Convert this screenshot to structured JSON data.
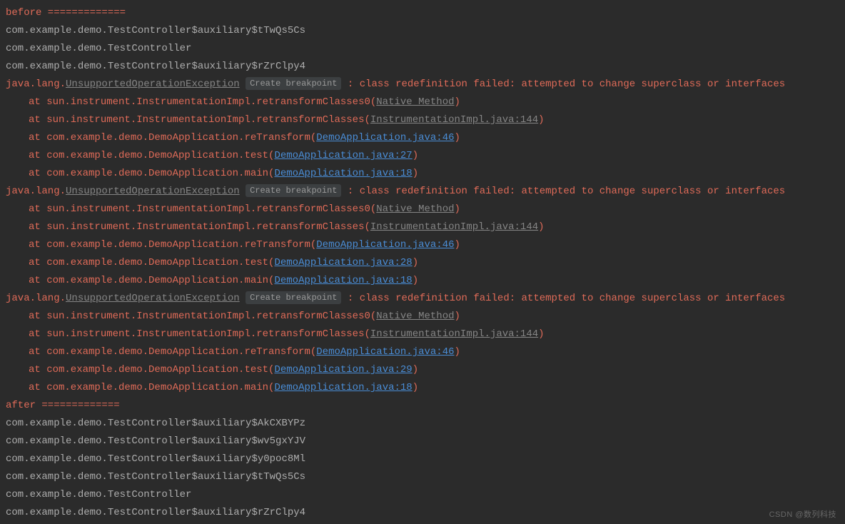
{
  "before_header": "before =============",
  "before_classes": [
    "com.example.demo.TestController$auxiliary$tTwQs5Cs",
    "com.example.demo.TestController",
    "com.example.demo.TestController$auxiliary$rZrClpy4"
  ],
  "exceptions": [
    {
      "prefix": "java.lang.",
      "name": "UnsupportedOperationException",
      "chip": "Create breakpoint",
      "message": ": class redefinition failed: attempted to change superclass or interfaces",
      "frames": [
        {
          "at": "at sun.instrument.InstrumentationImpl.retransformClasses0(",
          "link": "Native Method",
          "link_type": "grey",
          "suffix": ")"
        },
        {
          "at": "at sun.instrument.InstrumentationImpl.retransformClasses(",
          "link": "InstrumentationImpl.java:144",
          "link_type": "grey",
          "suffix": ")"
        },
        {
          "at": "at com.example.demo.DemoApplication.reTransform(",
          "link": "DemoApplication.java:46",
          "link_type": "blue",
          "suffix": ")"
        },
        {
          "at": "at com.example.demo.DemoApplication.test(",
          "link": "DemoApplication.java:27",
          "link_type": "blue",
          "suffix": ")"
        },
        {
          "at": "at com.example.demo.DemoApplication.main(",
          "link": "DemoApplication.java:18",
          "link_type": "blue",
          "suffix": ")"
        }
      ]
    },
    {
      "prefix": "java.lang.",
      "name": "UnsupportedOperationException",
      "chip": "Create breakpoint",
      "message": ": class redefinition failed: attempted to change superclass or interfaces",
      "frames": [
        {
          "at": "at sun.instrument.InstrumentationImpl.retransformClasses0(",
          "link": "Native Method",
          "link_type": "grey",
          "suffix": ")"
        },
        {
          "at": "at sun.instrument.InstrumentationImpl.retransformClasses(",
          "link": "InstrumentationImpl.java:144",
          "link_type": "grey",
          "suffix": ")"
        },
        {
          "at": "at com.example.demo.DemoApplication.reTransform(",
          "link": "DemoApplication.java:46",
          "link_type": "blue",
          "suffix": ")"
        },
        {
          "at": "at com.example.demo.DemoApplication.test(",
          "link": "DemoApplication.java:28",
          "link_type": "blue",
          "suffix": ")"
        },
        {
          "at": "at com.example.demo.DemoApplication.main(",
          "link": "DemoApplication.java:18",
          "link_type": "blue",
          "suffix": ")"
        }
      ]
    },
    {
      "prefix": "java.lang.",
      "name": "UnsupportedOperationException",
      "chip": "Create breakpoint",
      "message": ": class redefinition failed: attempted to change superclass or interfaces",
      "frames": [
        {
          "at": "at sun.instrument.InstrumentationImpl.retransformClasses0(",
          "link": "Native Method",
          "link_type": "grey",
          "suffix": ")"
        },
        {
          "at": "at sun.instrument.InstrumentationImpl.retransformClasses(",
          "link": "InstrumentationImpl.java:144",
          "link_type": "grey",
          "suffix": ")"
        },
        {
          "at": "at com.example.demo.DemoApplication.reTransform(",
          "link": "DemoApplication.java:46",
          "link_type": "blue",
          "suffix": ")"
        },
        {
          "at": "at com.example.demo.DemoApplication.test(",
          "link": "DemoApplication.java:29",
          "link_type": "blue",
          "suffix": ")"
        },
        {
          "at": "at com.example.demo.DemoApplication.main(",
          "link": "DemoApplication.java:18",
          "link_type": "blue",
          "suffix": ")"
        }
      ]
    }
  ],
  "after_header": "after =============",
  "after_classes": [
    "com.example.demo.TestController$auxiliary$AkCXBYPz",
    "com.example.demo.TestController$auxiliary$wv5gxYJV",
    "com.example.demo.TestController$auxiliary$y0poc8Ml",
    "com.example.demo.TestController$auxiliary$tTwQs5Cs",
    "com.example.demo.TestController",
    "com.example.demo.TestController$auxiliary$rZrClpy4"
  ],
  "watermark": "CSDN @数列科技"
}
